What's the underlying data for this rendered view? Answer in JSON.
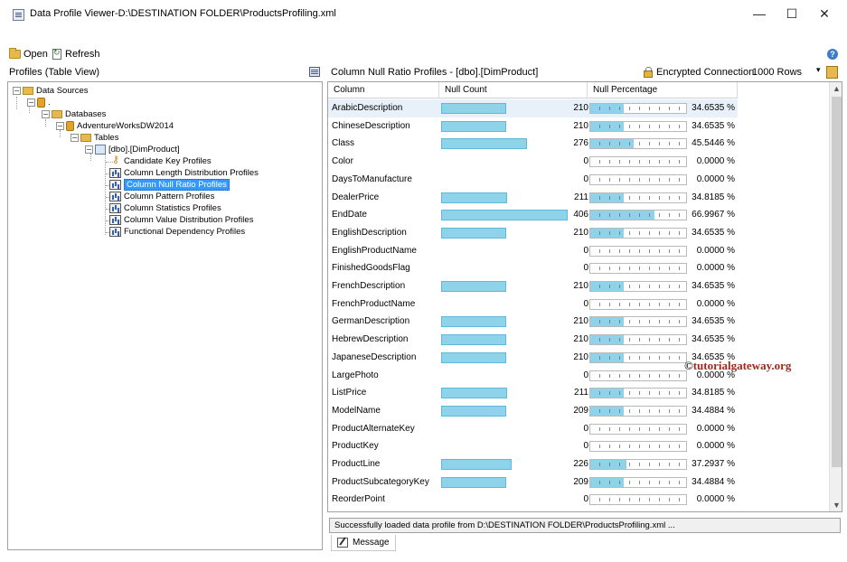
{
  "window": {
    "title": "Data Profile Viewer-D:\\DESTINATION FOLDER\\ProductsProfiling.xml",
    "minimize": "—",
    "maximize": "☐",
    "close": "✕"
  },
  "toolbar": {
    "open_label": "Open",
    "refresh_label": "Refresh",
    "help": "?"
  },
  "left_pane": {
    "header": "Profiles (Table View)",
    "tree": {
      "data_sources": "Data Sources",
      "server": ".",
      "databases": "Databases",
      "database": "AdventureWorksDW2014",
      "tables": "Tables",
      "table": "[dbo].[DimProduct]",
      "profiles": [
        "Candidate Key Profiles",
        "Column Length Distribution Profiles",
        "Column Null Ratio Profiles",
        "Column Pattern Profiles",
        "Column Statistics Profiles",
        "Column Value Distribution Profiles",
        "Functional Dependency Profiles"
      ],
      "expander_collapse": "−"
    }
  },
  "right_pane": {
    "title": "Column Null Ratio Profiles  -  [dbo].[DimProduct]",
    "encrypted": "Encrypted Connection",
    "rows": "1000 Rows",
    "dropdown": "▾",
    "columns": [
      "Column",
      "Null Count",
      "Null Percentage"
    ],
    "rows_data": [
      {
        "column": "ArabicDescription",
        "null_count": "210",
        "pct": "34.6535 %",
        "ratio": 0.346535
      },
      {
        "column": "ChineseDescription",
        "null_count": "210",
        "pct": "34.6535 %",
        "ratio": 0.346535
      },
      {
        "column": "Class",
        "null_count": "276",
        "pct": "45.5446 %",
        "ratio": 0.455446
      },
      {
        "column": "Color",
        "null_count": "0",
        "pct": "0.0000 %",
        "ratio": 0
      },
      {
        "column": "DaysToManufacture",
        "null_count": "0",
        "pct": "0.0000 %",
        "ratio": 0
      },
      {
        "column": "DealerPrice",
        "null_count": "211",
        "pct": "34.8185 %",
        "ratio": 0.348185
      },
      {
        "column": "EndDate",
        "null_count": "406",
        "pct": "66.9967 %",
        "ratio": 0.669967
      },
      {
        "column": "EnglishDescription",
        "null_count": "210",
        "pct": "34.6535 %",
        "ratio": 0.346535
      },
      {
        "column": "EnglishProductName",
        "null_count": "0",
        "pct": "0.0000 %",
        "ratio": 0
      },
      {
        "column": "FinishedGoodsFlag",
        "null_count": "0",
        "pct": "0.0000 %",
        "ratio": 0
      },
      {
        "column": "FrenchDescription",
        "null_count": "210",
        "pct": "34.6535 %",
        "ratio": 0.346535
      },
      {
        "column": "FrenchProductName",
        "null_count": "0",
        "pct": "0.0000 %",
        "ratio": 0
      },
      {
        "column": "GermanDescription",
        "null_count": "210",
        "pct": "34.6535 %",
        "ratio": 0.346535
      },
      {
        "column": "HebrewDescription",
        "null_count": "210",
        "pct": "34.6535 %",
        "ratio": 0.346535
      },
      {
        "column": "JapaneseDescription",
        "null_count": "210",
        "pct": "34.6535 %",
        "ratio": 0.346535
      },
      {
        "column": "LargePhoto",
        "null_count": "0",
        "pct": "0.0000 %",
        "ratio": 0
      },
      {
        "column": "ListPrice",
        "null_count": "211",
        "pct": "34.8185 %",
        "ratio": 0.348185
      },
      {
        "column": "ModelName",
        "null_count": "209",
        "pct": "34.4884 %",
        "ratio": 0.344884
      },
      {
        "column": "ProductAlternateKey",
        "null_count": "0",
        "pct": "0.0000 %",
        "ratio": 0
      },
      {
        "column": "ProductKey",
        "null_count": "0",
        "pct": "0.0000 %",
        "ratio": 0
      },
      {
        "column": "ProductLine",
        "null_count": "226",
        "pct": "37.2937 %",
        "ratio": 0.372937
      },
      {
        "column": "ProductSubcategoryKey",
        "null_count": "209",
        "pct": "34.4884 %",
        "ratio": 0.344884
      },
      {
        "column": "ReorderPoint",
        "null_count": "0",
        "pct": "0.0000 %",
        "ratio": 0
      }
    ]
  },
  "watermark": {
    "symbol": "©",
    "text": "tutorialgateway.org"
  },
  "status": {
    "message": "Successfully loaded data profile from D:\\DESTINATION FOLDER\\ProductsProfiling.xml ...",
    "tab_label": "Message"
  },
  "colors": {
    "bar": "#8fd3ea",
    "selection": "#3399ff",
    "watermark": "#9a2a1a"
  }
}
